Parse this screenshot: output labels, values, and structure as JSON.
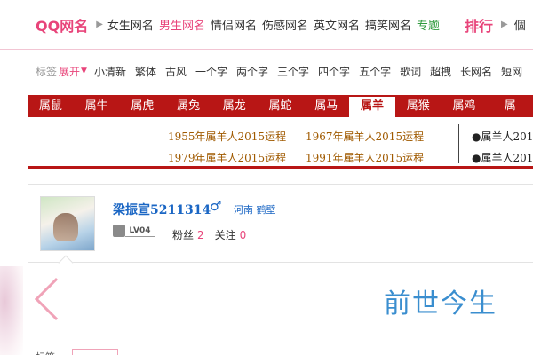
{
  "topnav": {
    "logo": "QQ网名",
    "links": [
      "女生网名",
      "男生网名",
      "情侣网名",
      "伤感网名",
      "英文网名",
      "搞笑网名",
      "专题"
    ],
    "rank": "排行",
    "rank_next": "個"
  },
  "tags": {
    "label": "标签",
    "open": "展开",
    "items": [
      "小清新",
      "繁体",
      "古风",
      "一个字",
      "两个字",
      "三个字",
      "四个字",
      "五个字",
      "歌词",
      "超拽",
      "长网名",
      "短网"
    ]
  },
  "zodiac": {
    "tabs": [
      "属鼠",
      "属牛",
      "属虎",
      "属兔",
      "属龙",
      "属蛇",
      "属马",
      "属羊",
      "属猴",
      "属鸡",
      "属"
    ]
  },
  "yearlinks": {
    "items": [
      "1955年属羊人2015运程",
      "1967年属羊人2015运程",
      "1979年属羊人2015运程",
      "1991年属羊人2015运程"
    ],
    "right": [
      "●属羊人201",
      "●属羊人201"
    ]
  },
  "profile": {
    "name": "梁振宣5211314",
    "gender_symbol": "♂",
    "location": "河南 鹤壁",
    "level": "LV04",
    "fans_label": "粉丝",
    "fans_count": "2",
    "follow_label": "关注",
    "follow_count": "0"
  },
  "content": {
    "title": "前世今生",
    "label": "标签"
  },
  "colors": {
    "brand_pink": "#e8447a",
    "zodiac_red": "#b81615",
    "link_blue": "#1a66c4",
    "title_blue": "#3a8ecf"
  }
}
